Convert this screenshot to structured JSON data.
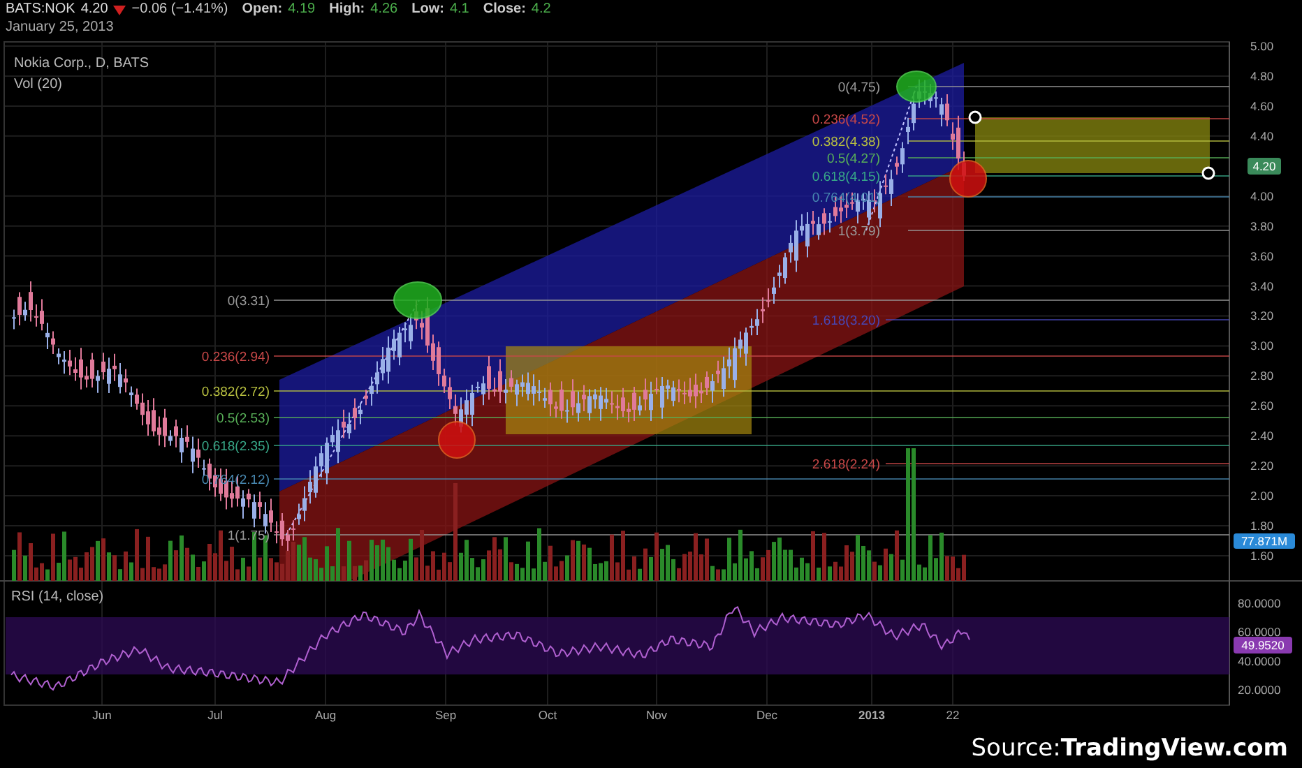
{
  "header": {
    "symbol": "BATS:NOK",
    "price": "4.20",
    "change": "−0.06 (−1.41%)",
    "ohlc": [
      {
        "label": "Open:",
        "value": "4.19"
      },
      {
        "label": "High:",
        "value": "4.26"
      },
      {
        "label": "Low:",
        "value": "4.1"
      },
      {
        "label": "Close:",
        "value": "4.2"
      }
    ],
    "date": "January 25, 2013"
  },
  "legend": {
    "title": "Nokia Corp., D, BATS",
    "volume": "Vol (20)"
  },
  "price_axis": [
    "5.00",
    "4.80",
    "4.60",
    "4.40",
    "4.00",
    "3.80",
    "3.60",
    "3.40",
    "3.20",
    "3.00",
    "2.80",
    "2.60",
    "2.40",
    "2.20",
    "2.00",
    "1.80",
    "1.60"
  ],
  "price_badge": "4.20",
  "volume_badge": "77.871M",
  "fib_left": [
    {
      "label": "0(3.31)",
      "color": "#9a9a9a"
    },
    {
      "label": "0.236(2.94)",
      "color": "#c84848"
    },
    {
      "label": "0.382(2.72)",
      "color": "#b8c040"
    },
    {
      "label": "0.5(2.53)",
      "color": "#58b058"
    },
    {
      "label": "0.618(2.35)",
      "color": "#38a888"
    },
    {
      "label": "0.764(2.12)",
      "color": "#4888b0"
    },
    {
      "label": "1(1.75)",
      "color": "#9a9a9a"
    }
  ],
  "fib_right": [
    {
      "label": "0(4.75)",
      "color": "#9a9a9a"
    },
    {
      "label": "0.236(4.52)",
      "color": "#c84848"
    },
    {
      "label": "0.382(4.38)",
      "color": "#b8c040"
    },
    {
      "label": "0.5(4.27)",
      "color": "#58b058"
    },
    {
      "label": "0.618(4.15)",
      "color": "#38a888"
    },
    {
      "label": "0.764(4.01)",
      "color": "#4888b0"
    },
    {
      "label": "1(3.79)",
      "color": "#9a9a9a"
    },
    {
      "label": "1.618(3.20)",
      "color": "#4848b8"
    },
    {
      "label": "2.618(2.24)",
      "color": "#c84848"
    }
  ],
  "rsi": {
    "title": "RSI (14, close)",
    "axis": [
      "80.0000",
      "60.0000",
      "40.0000",
      "20.0000"
    ],
    "badge": "49.9520"
  },
  "time_axis": [
    "Jun",
    "Jul",
    "Aug",
    "Sep",
    "Oct",
    "Nov",
    "Dec",
    "2013",
    "22"
  ],
  "source": {
    "label": "Source:",
    "site": "TradingView.com"
  }
}
